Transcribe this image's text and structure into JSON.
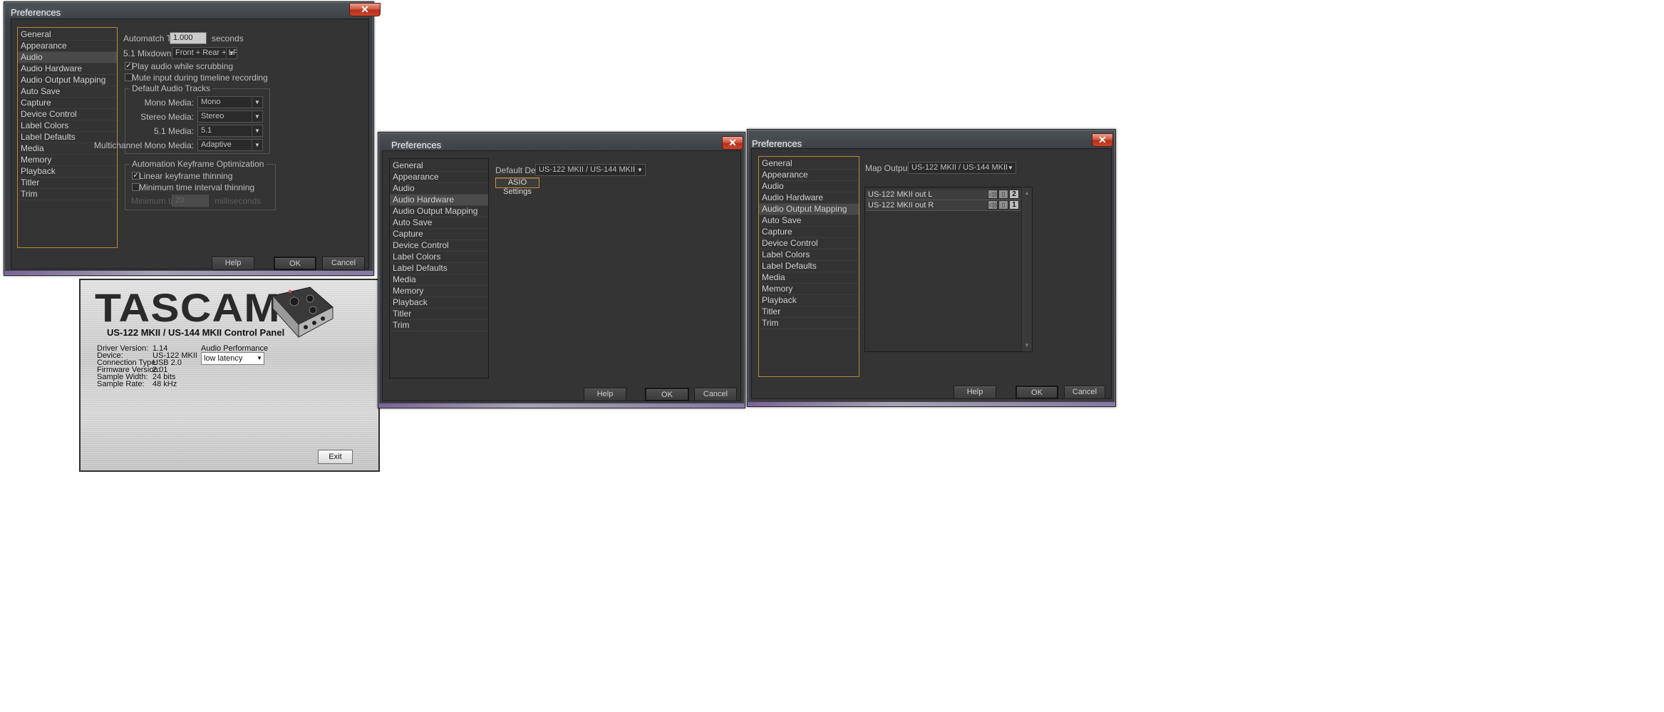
{
  "win1": {
    "title": "Preferences",
    "categories": [
      "General",
      "Appearance",
      "Audio",
      "Audio Hardware",
      "Audio Output Mapping",
      "Auto Save",
      "Capture",
      "Device Control",
      "Label Colors",
      "Label Defaults",
      "Media",
      "Memory",
      "Playback",
      "Titler",
      "Trim"
    ],
    "automatch_label": "Automatch Time:",
    "automatch_value": "1.000",
    "automatch_unit": "seconds",
    "mixdown_label": "5.1 Mixdown Type:",
    "mixdown_value": "Front + Rear + LFE",
    "play_scrub_label": "Play audio while scrubbing",
    "play_scrub_checked": true,
    "mute_input_label": "Mute input during timeline recording",
    "mute_input_checked": false,
    "default_tracks_title": "Default Audio Tracks",
    "mono_label": "Mono Media:",
    "mono_value": "Mono",
    "stereo_label": "Stereo Media:",
    "stereo_value": "Stereo",
    "five1_label": "5.1 Media:",
    "five1_value": "5.1",
    "multi_label": "Multichannel Mono Media:",
    "multi_value": "Adaptive",
    "keyframe_title": "Automation Keyframe Optimization",
    "linear_label": "Linear keyframe thinning",
    "linear_checked": true,
    "min_interval_label": "Minimum time interval thinning",
    "min_interval_checked": false,
    "min_time_label": "Minimum time:",
    "min_time_value": "20",
    "min_time_unit": "milliseconds",
    "help": "Help",
    "ok": "OK",
    "cancel": "Cancel"
  },
  "win2": {
    "title": "Preferences",
    "categories": [
      "General",
      "Appearance",
      "Audio",
      "Audio Hardware",
      "Audio Output Mapping",
      "Auto Save",
      "Capture",
      "Device Control",
      "Label Colors",
      "Label Defaults",
      "Media",
      "Memory",
      "Playback",
      "Titler",
      "Trim"
    ],
    "default_device_label": "Default Device:",
    "default_device_value": "US-122 MKII / US-144 MKII",
    "asio_button": "ASIO Settings",
    "help": "Help",
    "ok": "OK",
    "cancel": "Cancel"
  },
  "win3": {
    "title": "Preferences",
    "categories": [
      "General",
      "Appearance",
      "Audio",
      "Audio Hardware",
      "Audio Output Mapping",
      "Auto Save",
      "Capture",
      "Device Control",
      "Label Colors",
      "Label Defaults",
      "Media",
      "Memory",
      "Playback",
      "Titler",
      "Trim"
    ],
    "map_output_label": "Map Output for:",
    "map_output_value": "US-122 MKII / US-144 MKII",
    "outputs": [
      {
        "name": "US-122 MKII out L",
        "channel": "2"
      },
      {
        "name": "US-122 MKII out R",
        "channel": "1"
      }
    ],
    "help": "Help",
    "ok": "OK",
    "cancel": "Cancel"
  },
  "tascam": {
    "logo": "TASCAM",
    "subtitle": "US-122 MKII / US-144 MKII Control Panel",
    "info": [
      {
        "label": "Driver Version:",
        "value": "1.14"
      },
      {
        "label": "Device:",
        "value": "US-122 MKII"
      },
      {
        "label": "Connection Type:",
        "value": "USB 2.0"
      },
      {
        "label": "Firmware Version:",
        "value": "2.01"
      },
      {
        "label": "Sample Width:",
        "value": "24 bits"
      },
      {
        "label": "Sample Rate:",
        "value": "48 kHz"
      }
    ],
    "perf_label": "Audio Performance",
    "perf_value": "low latency",
    "exit": "Exit"
  },
  "colors": {
    "focus_border": "#b38a3a",
    "window_bg": "#343434",
    "close_red": "#c9472d"
  },
  "icons": [
    "close-icon",
    "dropdown-arrow-icon",
    "checkmark-icon",
    "speaker-icon",
    "channel-icon",
    "scroll-up-icon",
    "scroll-down-icon"
  ]
}
